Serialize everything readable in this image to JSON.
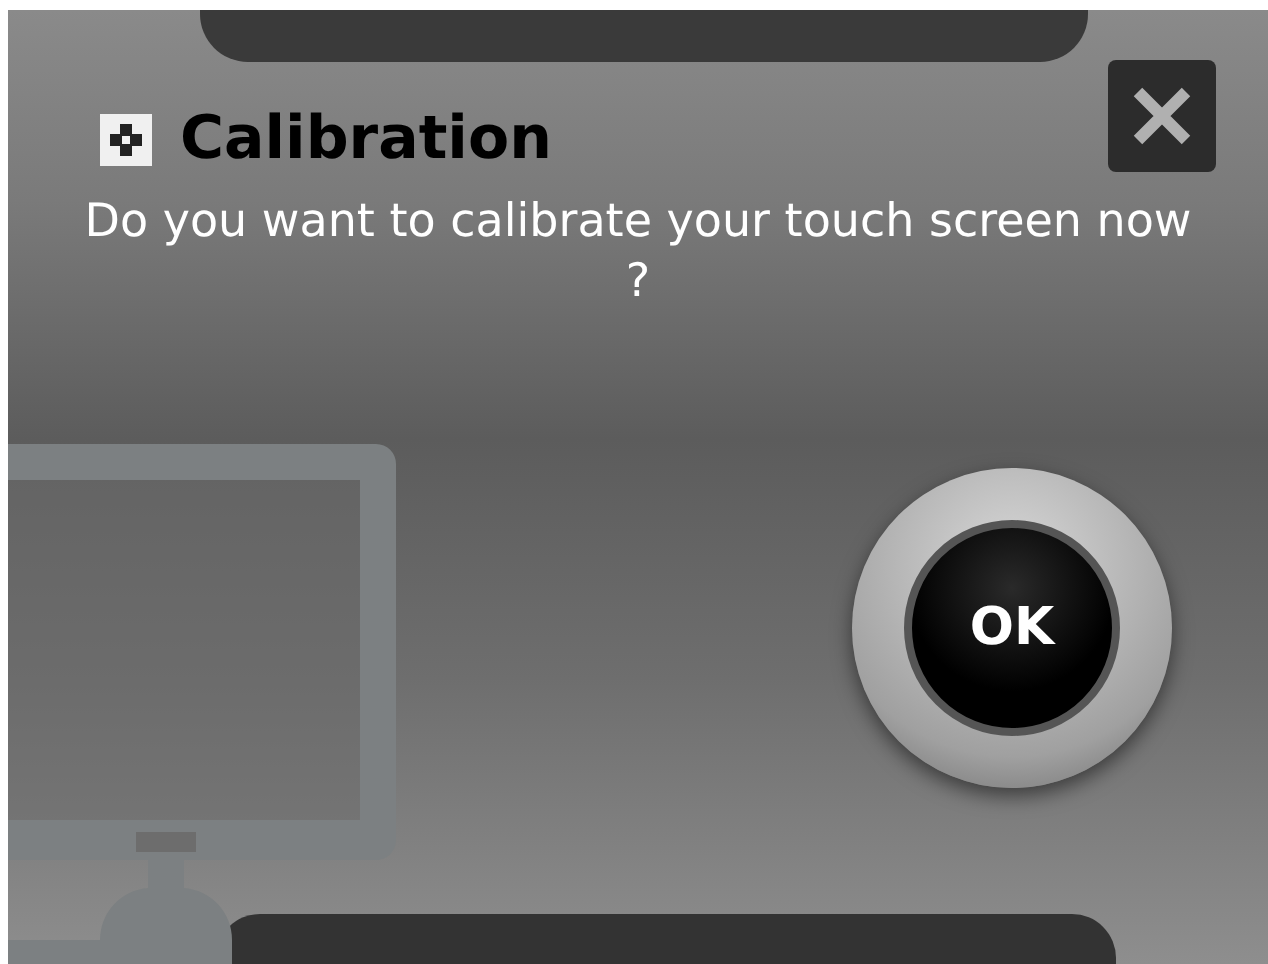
{
  "dialog": {
    "title": "Calibration",
    "message": "Do you want to calibrate your touch screen now ?",
    "ok_button": "OK"
  }
}
